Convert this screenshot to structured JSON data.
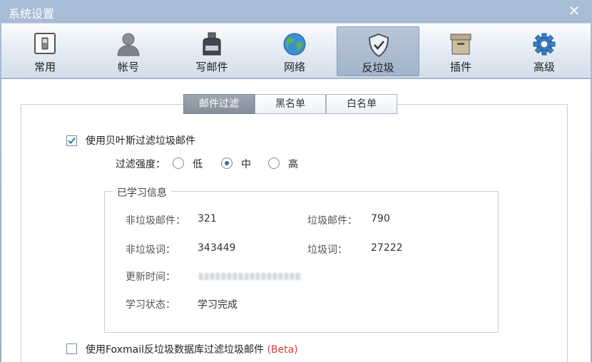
{
  "window": {
    "title": "系统设置",
    "close_glyph": "✕"
  },
  "toolbar": {
    "items": [
      {
        "label": "常用",
        "icon": "switch-icon"
      },
      {
        "label": "帐号",
        "icon": "user-icon"
      },
      {
        "label": "写邮件",
        "icon": "ink-bottle-icon"
      },
      {
        "label": "网络",
        "icon": "globe-icon"
      },
      {
        "label": "反垃圾",
        "icon": "shield-icon",
        "active": true
      },
      {
        "label": "插件",
        "icon": "box-icon"
      },
      {
        "label": "高级",
        "icon": "gear-icon"
      }
    ]
  },
  "tabs": [
    {
      "label": "邮件过滤",
      "active": true
    },
    {
      "label": "黑名单",
      "active": false
    },
    {
      "label": "白名单",
      "active": false
    }
  ],
  "bayes": {
    "label": "使用贝叶斯过滤垃圾邮件",
    "checked": true
  },
  "strength": {
    "label": "过滤强度：",
    "options": [
      {
        "label": "低",
        "selected": false
      },
      {
        "label": "中",
        "selected": true
      },
      {
        "label": "高",
        "selected": false
      }
    ]
  },
  "learned": {
    "title": "已学习信息",
    "non_spam_mail_label": "非垃圾邮件：",
    "non_spam_mail_value": "321",
    "spam_mail_label": "垃圾邮件：",
    "spam_mail_value": "790",
    "non_spam_words_label": "非垃圾词：",
    "non_spam_words_value": "343449",
    "spam_words_label": "垃圾词：",
    "spam_words_value": "27222",
    "update_time_label": "更新时间：",
    "status_label": "学习状态：",
    "status_value": "学习完成"
  },
  "foxmail_db": {
    "label": "使用Foxmail反垃圾数据库过滤垃圾邮件",
    "beta": "(Beta)",
    "checked": false
  },
  "colors": {
    "accent": "#2f6fb5",
    "beta": "#d9413a",
    "title_bar": "#a9bdd6"
  }
}
